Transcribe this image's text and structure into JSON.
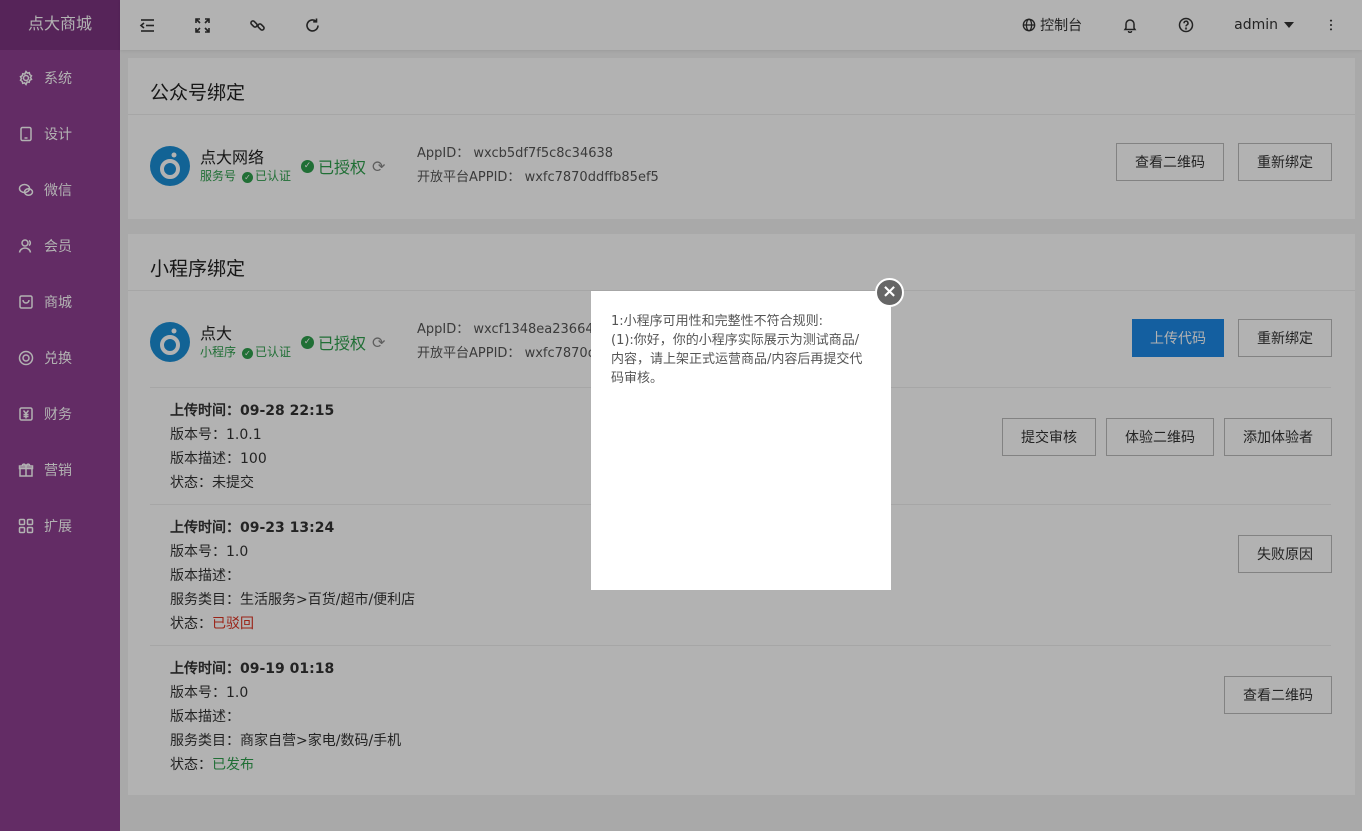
{
  "app": {
    "logo": "点大商城"
  },
  "sidebar": {
    "items": [
      {
        "label": "系统",
        "icon": "gear-icon"
      },
      {
        "label": "设计",
        "icon": "tablet-icon"
      },
      {
        "label": "微信",
        "icon": "wechat-icon"
      },
      {
        "label": "会员",
        "icon": "user-icon"
      },
      {
        "label": "商城",
        "icon": "shop-icon"
      },
      {
        "label": "兑换",
        "icon": "exchange-icon"
      },
      {
        "label": "财务",
        "icon": "finance-icon"
      },
      {
        "label": "营销",
        "icon": "gift-icon"
      },
      {
        "label": "扩展",
        "icon": "grid-icon"
      }
    ]
  },
  "header": {
    "console": "控制台",
    "user": "admin"
  },
  "gzh": {
    "title": "公众号绑定",
    "name": "点大网络",
    "type": "服务号",
    "certified": "已认证",
    "authorized": "已授权",
    "appid_label": "AppID：",
    "appid": "wxcb5df7f5c8c34638",
    "open_label": "开放平台APPID：",
    "open_appid": "wxfc7870ddffb85ef5",
    "btn_qr": "查看二维码",
    "btn_rebind": "重新绑定"
  },
  "mini": {
    "title": "小程序绑定",
    "name": "点大",
    "type": "小程序",
    "certified": "已认证",
    "authorized": "已授权",
    "appid_label": "AppID：",
    "appid": "wxcf1348ea23664583",
    "open_label": "开放平台APPID：",
    "open_appid": "wxfc7870dd",
    "btn_upload": "上传代码",
    "btn_rebind": "重新绑定"
  },
  "versions": [
    {
      "time_label": "上传时间：",
      "time": "09-28 22:15",
      "ver_label": "版本号：",
      "ver": "1.0.1",
      "desc_label": "版本描述：",
      "desc": "100",
      "status_label": "状态：",
      "status": "未提交",
      "btns": [
        "提交审核",
        "体验二维码",
        "添加体验者"
      ]
    },
    {
      "time_label": "上传时间：",
      "time": "09-23 13:24",
      "ver_label": "版本号：",
      "ver": "1.0",
      "desc_label": "版本描述：",
      "desc": "",
      "cat_label": "服务类目：",
      "cat": "生活服务>百货/超市/便利店",
      "status_label": "状态：",
      "status": "已驳回",
      "btns": [
        "失败原因"
      ]
    },
    {
      "time_label": "上传时间：",
      "time": "09-19 01:18",
      "ver_label": "版本号：",
      "ver": "1.0",
      "desc_label": "版本描述：",
      "desc": "",
      "cat_label": "服务类目：",
      "cat": "商家自营>家电/数码/手机",
      "status_label": "状态：",
      "status": "已发布",
      "btns": [
        "查看二维码"
      ]
    }
  ],
  "modal": {
    "line1": "1:小程序可用性和完整性不符合规则:",
    "line2": "(1):你好，你的小程序实际展示为测试商品/内容，请上架正式运营商品/内容后再提交代码审核。"
  },
  "colors": {
    "sidebar": "#8e3f91",
    "primary": "#1e88e5",
    "success": "#2e9f4d",
    "danger": "#d32222"
  }
}
